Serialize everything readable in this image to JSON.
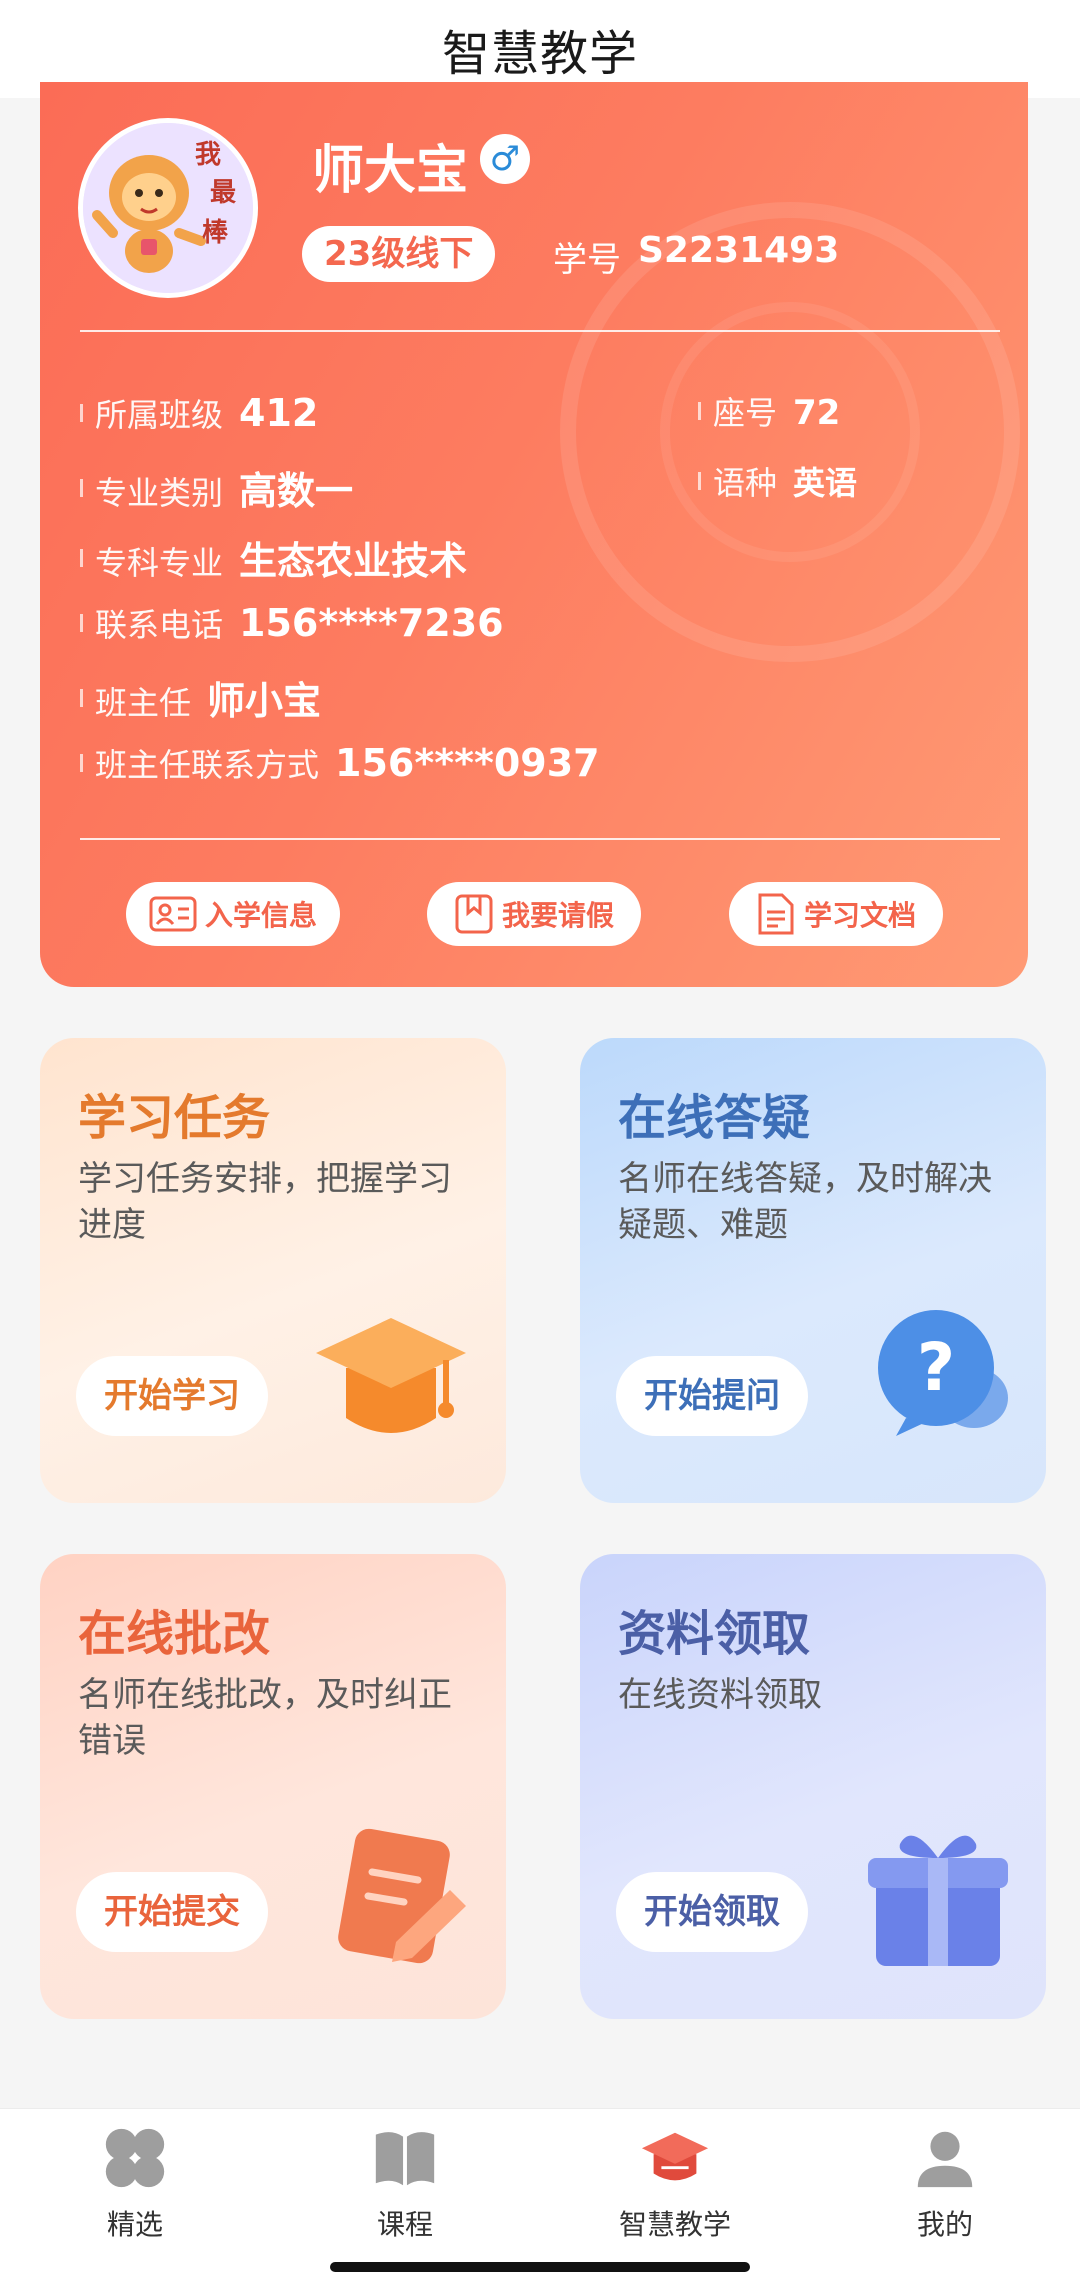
{
  "header": {
    "title": "智慧教学"
  },
  "profile": {
    "avatar_text": "我最棒",
    "name": "师大宝",
    "gender_symbol": "♂",
    "grade_tag": "23级线下",
    "student_id_label": "学号",
    "student_id": "S2231493",
    "fields": [
      {
        "label": "所属班级",
        "value": "412"
      },
      {
        "label": "专业类别",
        "value": "高数一"
      },
      {
        "label": "专科专业",
        "value": "生态农业技术"
      },
      {
        "label": "联系电话",
        "value": "156****7236"
      },
      {
        "label": "班主任",
        "value": "师小宝"
      },
      {
        "label": "班主任联系方式",
        "value": "156****0937"
      }
    ],
    "side_fields": [
      {
        "label": "座号",
        "value": "72"
      },
      {
        "label": "语种",
        "value": "英语"
      }
    ],
    "actions": [
      {
        "label": "入学信息",
        "icon": "id-card-icon"
      },
      {
        "label": "我要请假",
        "icon": "bookmark-icon"
      },
      {
        "label": "学习文档",
        "icon": "document-icon"
      }
    ]
  },
  "features": [
    {
      "title": "学习任务",
      "desc": "学习任务安排，把握学习进度",
      "button": "开始学习",
      "icon": "graduation-cap-icon",
      "color": "#e47a2d"
    },
    {
      "title": "在线答疑",
      "desc": "名师在线答疑，及时解决疑题、难题",
      "button": "开始提问",
      "icon": "question-bubble-icon",
      "color": "#3d6fb8"
    },
    {
      "title": "在线批改",
      "desc": "名师在线批改，及时纠正错误",
      "button": "开始提交",
      "icon": "edit-note-icon",
      "color": "#e9643c"
    },
    {
      "title": "资料领取",
      "desc": "在线资料领取",
      "button": "开始领取",
      "icon": "gift-icon",
      "color": "#4b5fa6"
    }
  ],
  "nav": {
    "items": [
      {
        "label": "精选",
        "icon": "grid-icon",
        "active": false
      },
      {
        "label": "课程",
        "icon": "book-icon",
        "active": false
      },
      {
        "label": "智慧教学",
        "icon": "cap-icon",
        "active": true
      },
      {
        "label": "我的",
        "icon": "user-icon",
        "active": false
      }
    ]
  },
  "colors": {
    "card_gradient_start": "#fb6c56",
    "card_gradient_end": "#ff9a74",
    "accent": "#f3644b",
    "nav_inactive": "#9e9e9e"
  }
}
